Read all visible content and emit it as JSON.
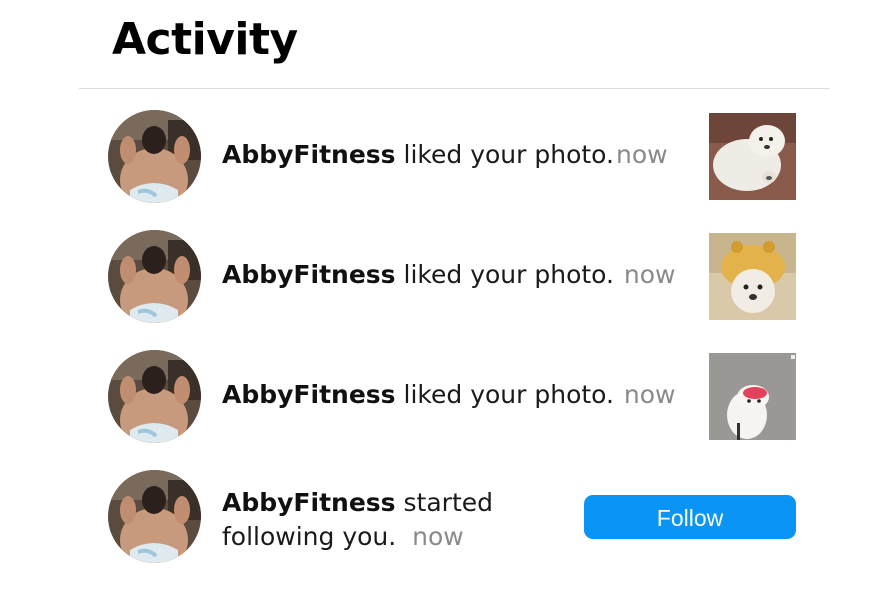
{
  "header": {
    "title": "Activity"
  },
  "notifications": [
    {
      "username": "AbbyFitness",
      "action": "liked your photo.",
      "time": "now",
      "thumb_icon": "dog-photo-thumbnail"
    },
    {
      "username": "AbbyFitness",
      "action": "liked your photo.",
      "time": "now",
      "thumb_icon": "dog-photo-thumbnail"
    },
    {
      "username": "AbbyFitness",
      "action": "liked your photo.",
      "time": "now",
      "thumb_icon": "dog-photo-thumbnail"
    },
    {
      "username": "AbbyFitness",
      "action_line1": "started",
      "action_line2": "following you.",
      "time": "now",
      "button_label": "Follow"
    }
  ],
  "colors": {
    "follow_button": "#0a95f5",
    "time_text": "#8a8a8a",
    "divider": "#dedede"
  }
}
